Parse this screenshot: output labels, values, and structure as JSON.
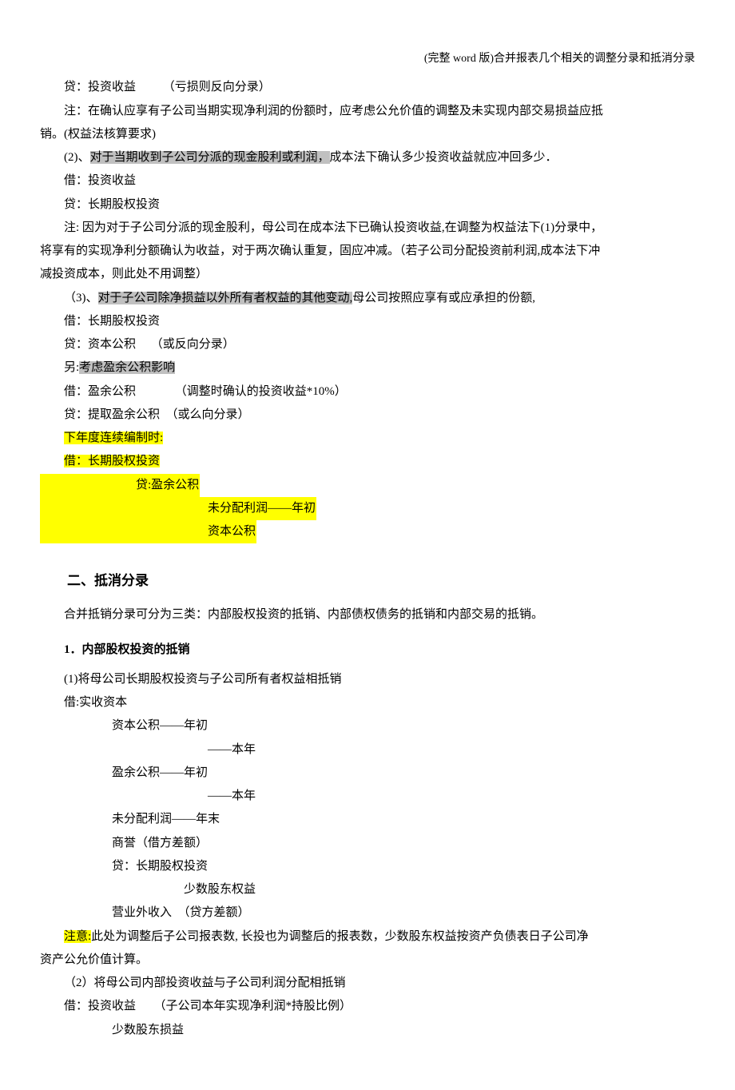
{
  "header": "(完整 word 版)合并报表几个相关的调整分录和抵消分录",
  "lines": {
    "l1": "贷：投资收益　　 （亏损则反向分录）",
    "l2a": "注：在确认应享有子公司当期实现净利润的份额时，应考虑公允价值的调整及未实现内部交易损益应抵",
    "l2b": "销。(权益法核算要求)",
    "l3a": "(2)、",
    "l3b": "对于当期收到子公司分派的现金股利或利润，",
    "l3c": "成本法下确认多少投资收益就应冲回多少．",
    "l4": "借：投资收益",
    "l5": "贷：长期股权投资",
    "l6a": "注: 因为对于子公司分派的现金股利，母公司在成本法下已确认投资收益,在调整为权益法下(1)分录中，",
    "l6b": "将享有的实现净利分额确认为收益，对于两次确认重复，固应冲减。（若子公司分配投资前利润,成本法下冲",
    "l6c": "减投资成本，则此处不用调整）",
    "l7a": "（3)、",
    "l7b": "对于子公司除净损益以外所有者权益的其他变动,",
    "l7c": "母公司按照应享有或应承担的份额,",
    "l8": "借：长期股权投资",
    "l9": "贷：资本公积　 （或反向分录）",
    "l10a": "另:",
    "l10b": "考虑盈余公积影响",
    "l11": "借：盈余公积　　　 （调整时确认的投资收益*10%）",
    "l12": "贷：提取盈余公积　（或么向分录）",
    "l13": "下年度连续编制时:",
    "l14": "借：长期股权投资",
    "l15": "贷:盈余公积",
    "l16": "未分配利润——年初",
    "l17": "资本公积",
    "sec2": "二、抵消分录",
    "intro2": "合并抵销分录可分为三类：内部股权投资的抵销、内部债权债务的抵销和内部交易的抵销。",
    "sub1": "1．内部股权投资的抵销",
    "s1_1": "(1)将母公司长期股权投资与子公司所有者权益相抵销",
    "s1_2": "借:实收资本",
    "s1_3": "资本公积——年初",
    "s1_4": "——本年",
    "s1_5": "盈余公积——年初",
    "s1_6": "——本年",
    "s1_7": "未分配利润——年末",
    "s1_8": "商誉（借方差额）",
    "s1_9": "贷：长期股权投资",
    "s1_10": "少数股东权益",
    "s1_11": "营业外收入　（贷方差额）",
    "note_a": "注意:",
    "note_b": "此处为调整后子公司报表数, 长投也为调整后的报表数，少数股东权益按资产负债表日子公司净",
    "note_c": "资产公允价值计算。",
    "s2_1": "（2）将母公司内部投资收益与子公司利润分配相抵销",
    "s2_2": "借：投资收益　　（子公司本年实现净利润*持股比例）",
    "s2_3": "少数股东损益"
  }
}
